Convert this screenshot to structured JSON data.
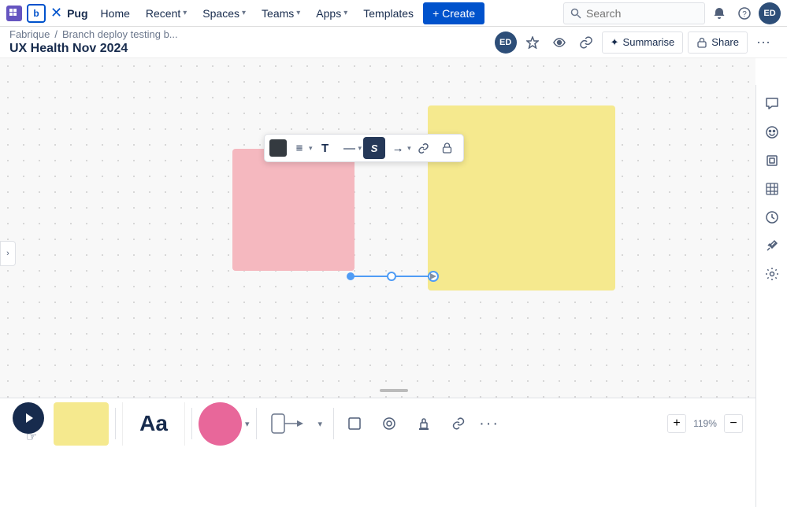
{
  "nav": {
    "brand": "b",
    "cross": "✕",
    "pug": "Pug",
    "home": "Home",
    "recent": "Recent",
    "spaces": "Spaces",
    "teams": "Teams",
    "apps": "Apps",
    "templates": "Templates",
    "create_label": "+ Create",
    "search_placeholder": "Search",
    "search_label": "Search"
  },
  "second_row": {
    "breadcrumb_root": "Fabrique",
    "breadcrumb_separator": "/",
    "breadcrumb_page": "Branch deploy testing b...",
    "page_title": "UX Health Nov 2024",
    "summarise_label": "Summarise",
    "share_label": "Share",
    "avatar_initials": "ED"
  },
  "toolbar": {
    "color_swatch": "#343a40",
    "align": "≡",
    "text": "T",
    "dash": "—",
    "style": "S",
    "arrow": "→",
    "link": "⚲",
    "lock": "🔒"
  },
  "right_sidebar": {
    "icons": [
      "💬",
      "👍",
      "⬜",
      "▦",
      "🕐",
      "✦",
      "⚙"
    ]
  },
  "bottom_toolbar": {
    "text_preview": "Aa",
    "zoom_level": "119%",
    "zoom_plus": "+",
    "zoom_minus": "−",
    "more": "···"
  },
  "canvas": {
    "pink_rect": "pink-shape",
    "yellow_rect": "yellow-shape"
  }
}
